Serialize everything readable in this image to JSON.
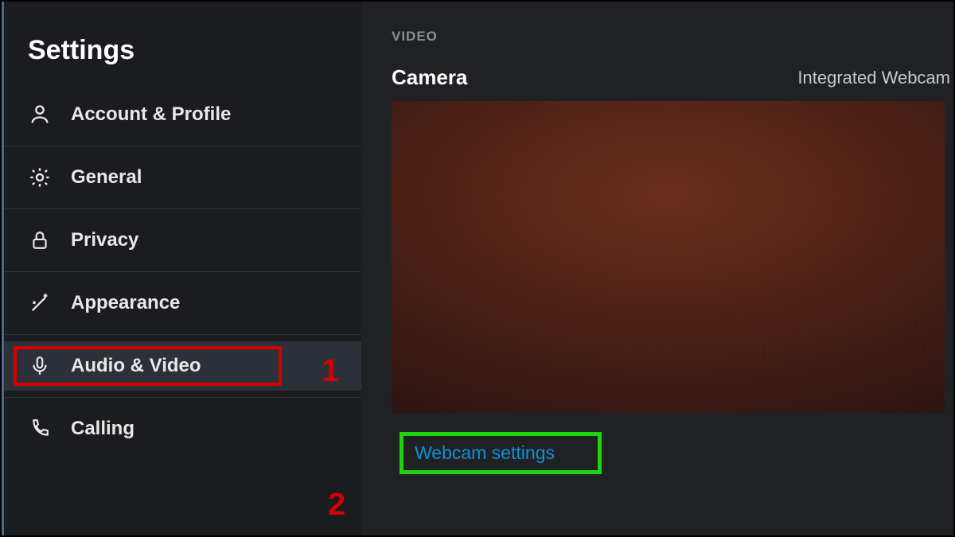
{
  "sidebar": {
    "title": "Settings",
    "items": [
      {
        "label": "Account & Profile"
      },
      {
        "label": "General"
      },
      {
        "label": "Privacy"
      },
      {
        "label": "Appearance"
      },
      {
        "label": "Audio & Video"
      },
      {
        "label": "Calling"
      }
    ]
  },
  "main": {
    "video_section_header": "VIDEO",
    "camera_label": "Camera",
    "camera_selected": "Integrated Webcam",
    "webcam_settings_label": "Webcam settings"
  },
  "annotations": {
    "step1": "1",
    "step2": "2"
  }
}
